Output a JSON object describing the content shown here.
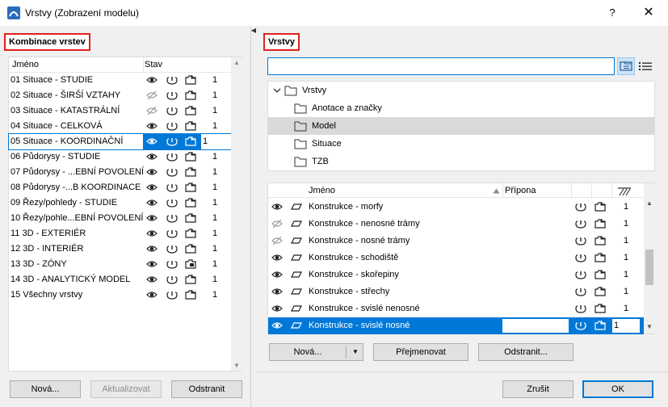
{
  "window": {
    "title": "Vrstvy (Zobrazení modelu)",
    "help": "?",
    "close": "✕"
  },
  "left": {
    "title": "Kombinace vrstev",
    "col_name": "Jméno",
    "col_state": "Stav",
    "rows": [
      {
        "name": "01 Situace - STUDIE",
        "eye": "on",
        "folder": "normal",
        "num": "1"
      },
      {
        "name": "02 Situace - ŠIRŠÍ VZTAHY",
        "eye": "off",
        "folder": "normal",
        "num": "1"
      },
      {
        "name": "03 Situace - KATASTRÁLNÍ",
        "eye": "off",
        "folder": "normal",
        "num": "1"
      },
      {
        "name": "04 Situace - CELKOVÁ",
        "eye": "on",
        "folder": "normal",
        "num": "1"
      },
      {
        "name": "05 Situace - KOORDINAČNÍ",
        "eye": "on",
        "folder": "normal",
        "num": "1"
      },
      {
        "name": "06 Půdorysy - STUDIE",
        "eye": "on",
        "folder": "normal",
        "num": "1"
      },
      {
        "name": "07 Půdorysy - ...EBNÍ POVOLENÍ",
        "eye": "on",
        "folder": "normal",
        "num": "1"
      },
      {
        "name": "08 Půdorysy -...B KOORDINACE",
        "eye": "on",
        "folder": "normal",
        "num": "1"
      },
      {
        "name": "09 Řezy/pohledy - STUDIE",
        "eye": "on",
        "folder": "normal",
        "num": "1"
      },
      {
        "name": "10 Řezy/pohle...EBNÍ POVOLENÍ",
        "eye": "on",
        "folder": "normal",
        "num": "1"
      },
      {
        "name": "11 3D - EXTERIÉR",
        "eye": "on",
        "folder": "normal",
        "num": "1"
      },
      {
        "name": "12 3D - INTERIÉR",
        "eye": "on",
        "folder": "normal",
        "num": "1"
      },
      {
        "name": "13 3D - ZÓNY",
        "eye": "on",
        "folder": "mixed",
        "num": "1"
      },
      {
        "name": "14 3D - ANALYTICKÝ MODEL",
        "eye": "on",
        "folder": "normal",
        "num": "1"
      },
      {
        "name": "15 Všechny vrstvy",
        "eye": "on",
        "folder": "normal",
        "num": "1"
      }
    ],
    "selected_index": 4,
    "btn_new": "Nová...",
    "btn_update": "Aktualizovat",
    "btn_delete": "Odstranit"
  },
  "right": {
    "title": "Vrstvy",
    "search_value": "",
    "tree": [
      {
        "label": "Vrstvy",
        "level": 0,
        "expanded": true
      },
      {
        "label": "Anotace a značky",
        "level": 1
      },
      {
        "label": "Model",
        "level": 1,
        "selected": true
      },
      {
        "label": "Situace",
        "level": 1
      },
      {
        "label": "TZB",
        "level": 1
      }
    ],
    "col_name": "Jméno",
    "col_ext": "Přípona",
    "layers": [
      {
        "name": "Konstrukce - morfy",
        "eye": "on",
        "num": "1"
      },
      {
        "name": "Konstrukce - nenosné trámy",
        "eye": "off",
        "num": "1"
      },
      {
        "name": "Konstrukce - nosné trámy",
        "eye": "off",
        "num": "1"
      },
      {
        "name": "Konstrukce - schodiště",
        "eye": "on",
        "num": "1"
      },
      {
        "name": "Konstrukce - skořepiny",
        "eye": "on",
        "num": "1"
      },
      {
        "name": "Konstrukce - střechy",
        "eye": "on",
        "num": "1"
      },
      {
        "name": "Konstrukce - svislé nenosné",
        "eye": "on",
        "num": "1"
      },
      {
        "name": "Konstrukce - svislé nosné",
        "eye": "on",
        "num": "1"
      }
    ],
    "selected_layer": 7,
    "btn_new": "Nová...",
    "btn_rename": "Přejmenovat",
    "btn_delete": "Odstranit...",
    "btn_cancel": "Zrušit",
    "btn_ok": "OK"
  },
  "colors": {
    "accent": "#0078d7",
    "highlight_red": "#e02020",
    "tree_selected": "#d9d9d9"
  }
}
